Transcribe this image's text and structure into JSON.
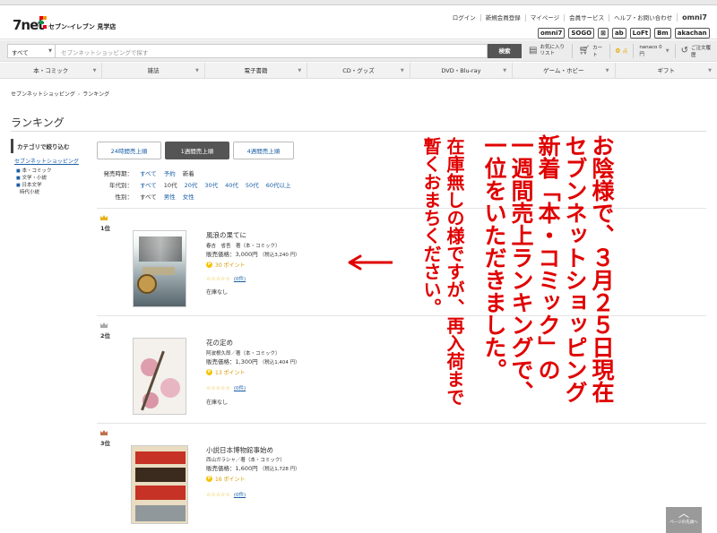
{
  "header": {
    "store_name": "セブン-イレブン 見学店",
    "top_links": [
      "ログイン",
      "新規会員登録",
      "マイページ",
      "会員サービス",
      "ヘルプ・お問い合わせ"
    ],
    "omni_logo": "omni7",
    "brand_logos": [
      "omni7",
      "SOGO",
      "⊠",
      "ab",
      "LoFt",
      "Bm",
      "akachan"
    ]
  },
  "search": {
    "category": "すべて",
    "placeholder": "セブンネットショッピングで探す",
    "button": "検索"
  },
  "utility": {
    "favorites": "お気に入りリスト",
    "cart": "カート",
    "points": "0",
    "points_unit": "点",
    "nanaco": "nanaco 0円",
    "history": "ご注文履歴"
  },
  "nav": [
    "本・コミック",
    "雑誌",
    "電子書籍",
    "CD・グッズ",
    "DVD・Blu-ray",
    "ゲーム・ホビー",
    "ギフト"
  ],
  "breadcrumb": [
    "セブンネットショッピング",
    "ランキング"
  ],
  "page_title": "ランキング",
  "sidebar": {
    "heading": "カテゴリで絞り込む",
    "root": "セブンネットショッピング",
    "items": [
      "本・コミック",
      "文学・小説",
      "日本文学",
      "時代小説"
    ]
  },
  "tabs": [
    {
      "label": "24時間売上順",
      "active": false
    },
    {
      "label": "1週間売上順",
      "active": true
    },
    {
      "label": "4週間売上順",
      "active": false
    }
  ],
  "filters": {
    "release": {
      "label": "発売時期：",
      "options": [
        "すべて",
        "予約",
        "新着"
      ],
      "selected": "新着"
    },
    "age": {
      "label": "年代別：",
      "options": [
        "すべて",
        "10代",
        "20代",
        "30代",
        "40代",
        "50代",
        "60代以上"
      ],
      "selected": "10代"
    },
    "gender": {
      "label": "性別：",
      "options": [
        "すべて",
        "男性",
        "女性"
      ],
      "selected": "すべて"
    }
  },
  "items": [
    {
      "rank": "1位",
      "crown": "#e6b31e",
      "title": "風浪の果てに",
      "author": "春吉　省吾　著（本・コミック）",
      "price_label": "販売価格：",
      "price": "3,000円",
      "tax": "（税込3,240 円）",
      "points": "30 ポイント",
      "stars": "☆☆☆☆☆",
      "reviews": "(0件)",
      "stock": "在庫なし"
    },
    {
      "rank": "2位",
      "crown": "#a8a8a8",
      "title": "花の定め",
      "author": "阿波根久郎／著（本・コミック）",
      "price_label": "販売価格：",
      "price": "1,300円",
      "tax": "（税込1,404 円）",
      "points": "13 ポイント",
      "stars": "☆☆☆☆☆",
      "reviews": "(0件)",
      "stock": "在庫なし"
    },
    {
      "rank": "3位",
      "crown": "#c0704a",
      "title": "小説日本博物館事始め",
      "author": "西山ガラシャ／著（本・コミック）",
      "price_label": "販売価格：",
      "price": "1,600円",
      "tax": "（税込1,728 円）",
      "points": "16 ポイント",
      "stars": "☆☆☆☆☆",
      "reviews": "(0件)",
      "stock": ""
    }
  ],
  "annotation": {
    "columns": [
      "お陰様で、３月２５日現在",
      "セブンネットショッピング",
      "新着「本・コミック」の",
      "一週間売上ランキングで、",
      "一位をいただきました。"
    ],
    "note": [
      "在庫無しの様ですが、再入荷まで",
      "暫くおまちください。"
    ],
    "color": "#e00000"
  },
  "back_to_top": {
    "label": "ページの先頭へ"
  }
}
